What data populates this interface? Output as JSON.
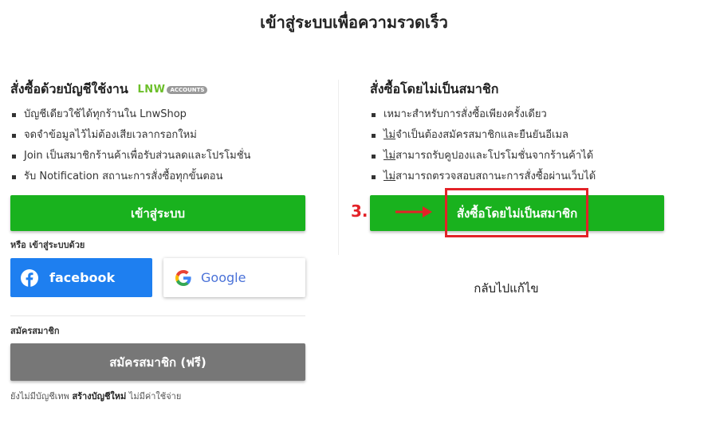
{
  "page_title": "เข้าสู่ระบบเพื่อความรวดเร็ว",
  "left": {
    "heading": "สั่งซื้อด้วยบัญชีใช้งาน",
    "lnw_logo_text": "LNW",
    "lnw_badge": "ACCOUNTS",
    "bullets": [
      "บัญชีเดียวใช้ได้ทุกร้านใน LnwShop",
      "จดจำข้อมูลไว้ไม่ต้องเสียเวลากรอกใหม่",
      "Join เป็นสมาชิกร้านค้าเพื่อรับส่วนลดและโปรโมชั่น",
      "รับ Notification สถานะการสั่งซื้อทุกขั้นตอน"
    ],
    "login_button": "เข้าสู่ระบบ",
    "or_login_with": "หรือ เข้าสู่ระบบด้วย",
    "facebook_label": "facebook",
    "google_label": "Google",
    "register_label": "สมัครสมาชิก",
    "register_button": "สมัครสมาชิก (ฟรี)",
    "footer_prefix": "ยังไม่มีบัญชีเทพ",
    "footer_link": "สร้างบัญชีใหม่",
    "footer_suffix": "ไม่มีค่าใช้จ่าย"
  },
  "right": {
    "heading": "สั่งซื้อโดยไม่เป็นสมาชิก",
    "bullets": [
      {
        "prefix": "",
        "text": "เหมาะสำหรับการสั่งซื้อเพียงครั้งเดียว"
      },
      {
        "prefix": "ไม่",
        "text": "จำเป็นต้องสมัครสมาชิกและยืนยันอีเมล"
      },
      {
        "prefix": "ไม่",
        "text": "สามารถรับคูปองและโปรโมชั่นจากร้านค้าได้"
      },
      {
        "prefix": "ไม่",
        "text": "สามารถตรวจสอบสถานะการสั่งซื้อผ่านเว็บได้"
      }
    ],
    "guest_button": "สั่งซื้อโดยไม่เป็นสมาชิก",
    "back_link": "กลับไปแก้ไข"
  },
  "annotation": {
    "step_label": "3.",
    "color": "#e32228"
  },
  "colors": {
    "green": "#19b21e",
    "gray": "#777777",
    "facebook": "#1e7ff0"
  },
  "icons": [
    "facebook-icon",
    "google-icon",
    "arrow-right-icon"
  ]
}
